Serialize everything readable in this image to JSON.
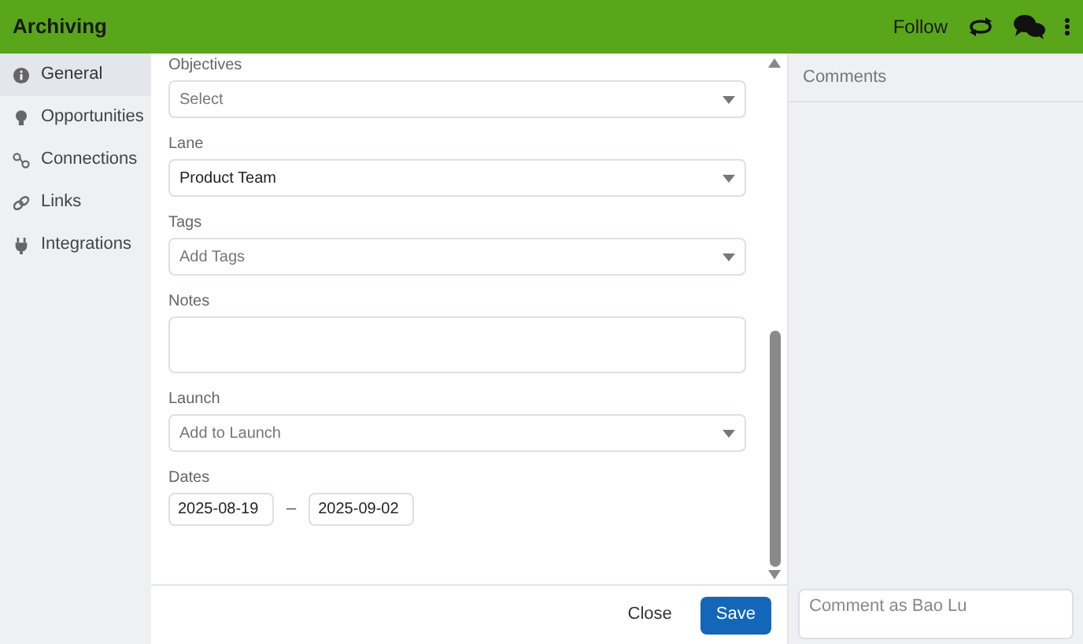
{
  "header": {
    "title": "Archiving",
    "follow": "Follow"
  },
  "sidebar": {
    "items": [
      {
        "label": "General",
        "selected": true,
        "kind": "info"
      },
      {
        "label": "Opportunities",
        "selected": false,
        "kind": "bulb"
      },
      {
        "label": "Connections",
        "selected": false,
        "kind": "connect"
      },
      {
        "label": "Links",
        "selected": false,
        "kind": "link"
      },
      {
        "label": "Integrations",
        "selected": false,
        "kind": "plug"
      }
    ]
  },
  "form": {
    "fields": [
      {
        "kind": "select",
        "label": "Objectives",
        "placeholder": "Select"
      },
      {
        "kind": "select",
        "label": "Lane",
        "value": "Product Team"
      },
      {
        "kind": "select",
        "label": "Tags",
        "placeholder": "Add Tags"
      },
      {
        "kind": "textarea",
        "label": "Notes"
      },
      {
        "kind": "select",
        "label": "Launch",
        "placeholder": "Add to Launch"
      },
      {
        "kind": "daterange",
        "label": "Dates",
        "start": "2025-08-19",
        "separator": "–",
        "end": "2025-09-02"
      }
    ]
  },
  "footer": {
    "buttons": [
      {
        "label": "Close",
        "kind": "secondary"
      },
      {
        "label": "Save",
        "kind": "primary"
      }
    ]
  },
  "comments": {
    "title": "Comments",
    "placeholder": "Comment as Bao Lu"
  }
}
